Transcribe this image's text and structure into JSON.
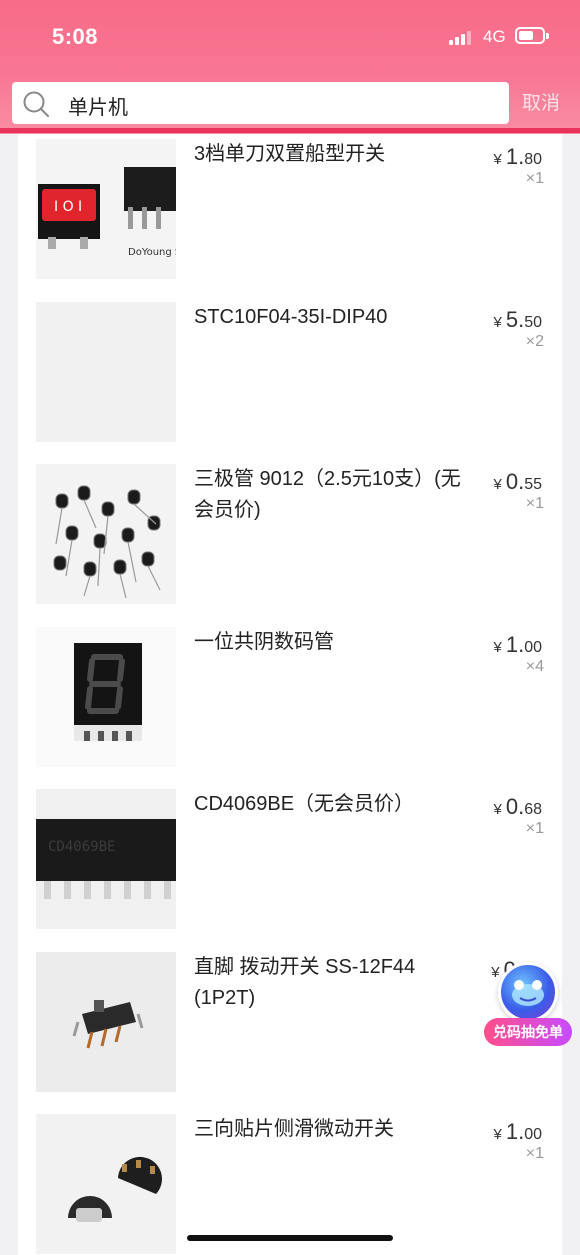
{
  "status_bar": {
    "time": "5:08",
    "network": "4G"
  },
  "search": {
    "query": "单片机",
    "cancel_label": "取消"
  },
  "items": [
    {
      "title": "3档单刀双置船型开关",
      "price_int": "1.",
      "price_dec": "80",
      "qty": "×1",
      "currency": "¥",
      "thumb_text": "DoYoung Studio"
    },
    {
      "title": "STC10F04-35I-DIP40",
      "price_int": "5.",
      "price_dec": "50",
      "qty": "×2",
      "currency": "¥",
      "thumb_text": ""
    },
    {
      "title": "三极管 9012（2.5元10支）(无会员价)",
      "price_int": "0.",
      "price_dec": "55",
      "qty": "×1",
      "currency": "¥",
      "thumb_text": ""
    },
    {
      "title": "一位共阴数码管",
      "price_int": "1.",
      "price_dec": "00",
      "qty": "×4",
      "currency": "¥",
      "thumb_text": ""
    },
    {
      "title": "CD4069BE（无会员价）",
      "price_int": "0.",
      "price_dec": "68",
      "qty": "×1",
      "currency": "¥",
      "thumb_text": "CD4069BE"
    },
    {
      "title": "直脚 拨动开关 SS-12F44 (1P2T)",
      "price_int": "0.",
      "price_dec": "",
      "qty": "",
      "currency": "¥",
      "thumb_text": ""
    },
    {
      "title": "三向贴片侧滑微动开关",
      "price_int": "1.",
      "price_dec": "00",
      "qty": "×1",
      "currency": "¥",
      "thumb_text": ""
    }
  ],
  "float_badge": {
    "label": "兑码抽免单"
  },
  "colors": {
    "header_pink": "#f76b88",
    "accent_red": "#e8335a"
  }
}
